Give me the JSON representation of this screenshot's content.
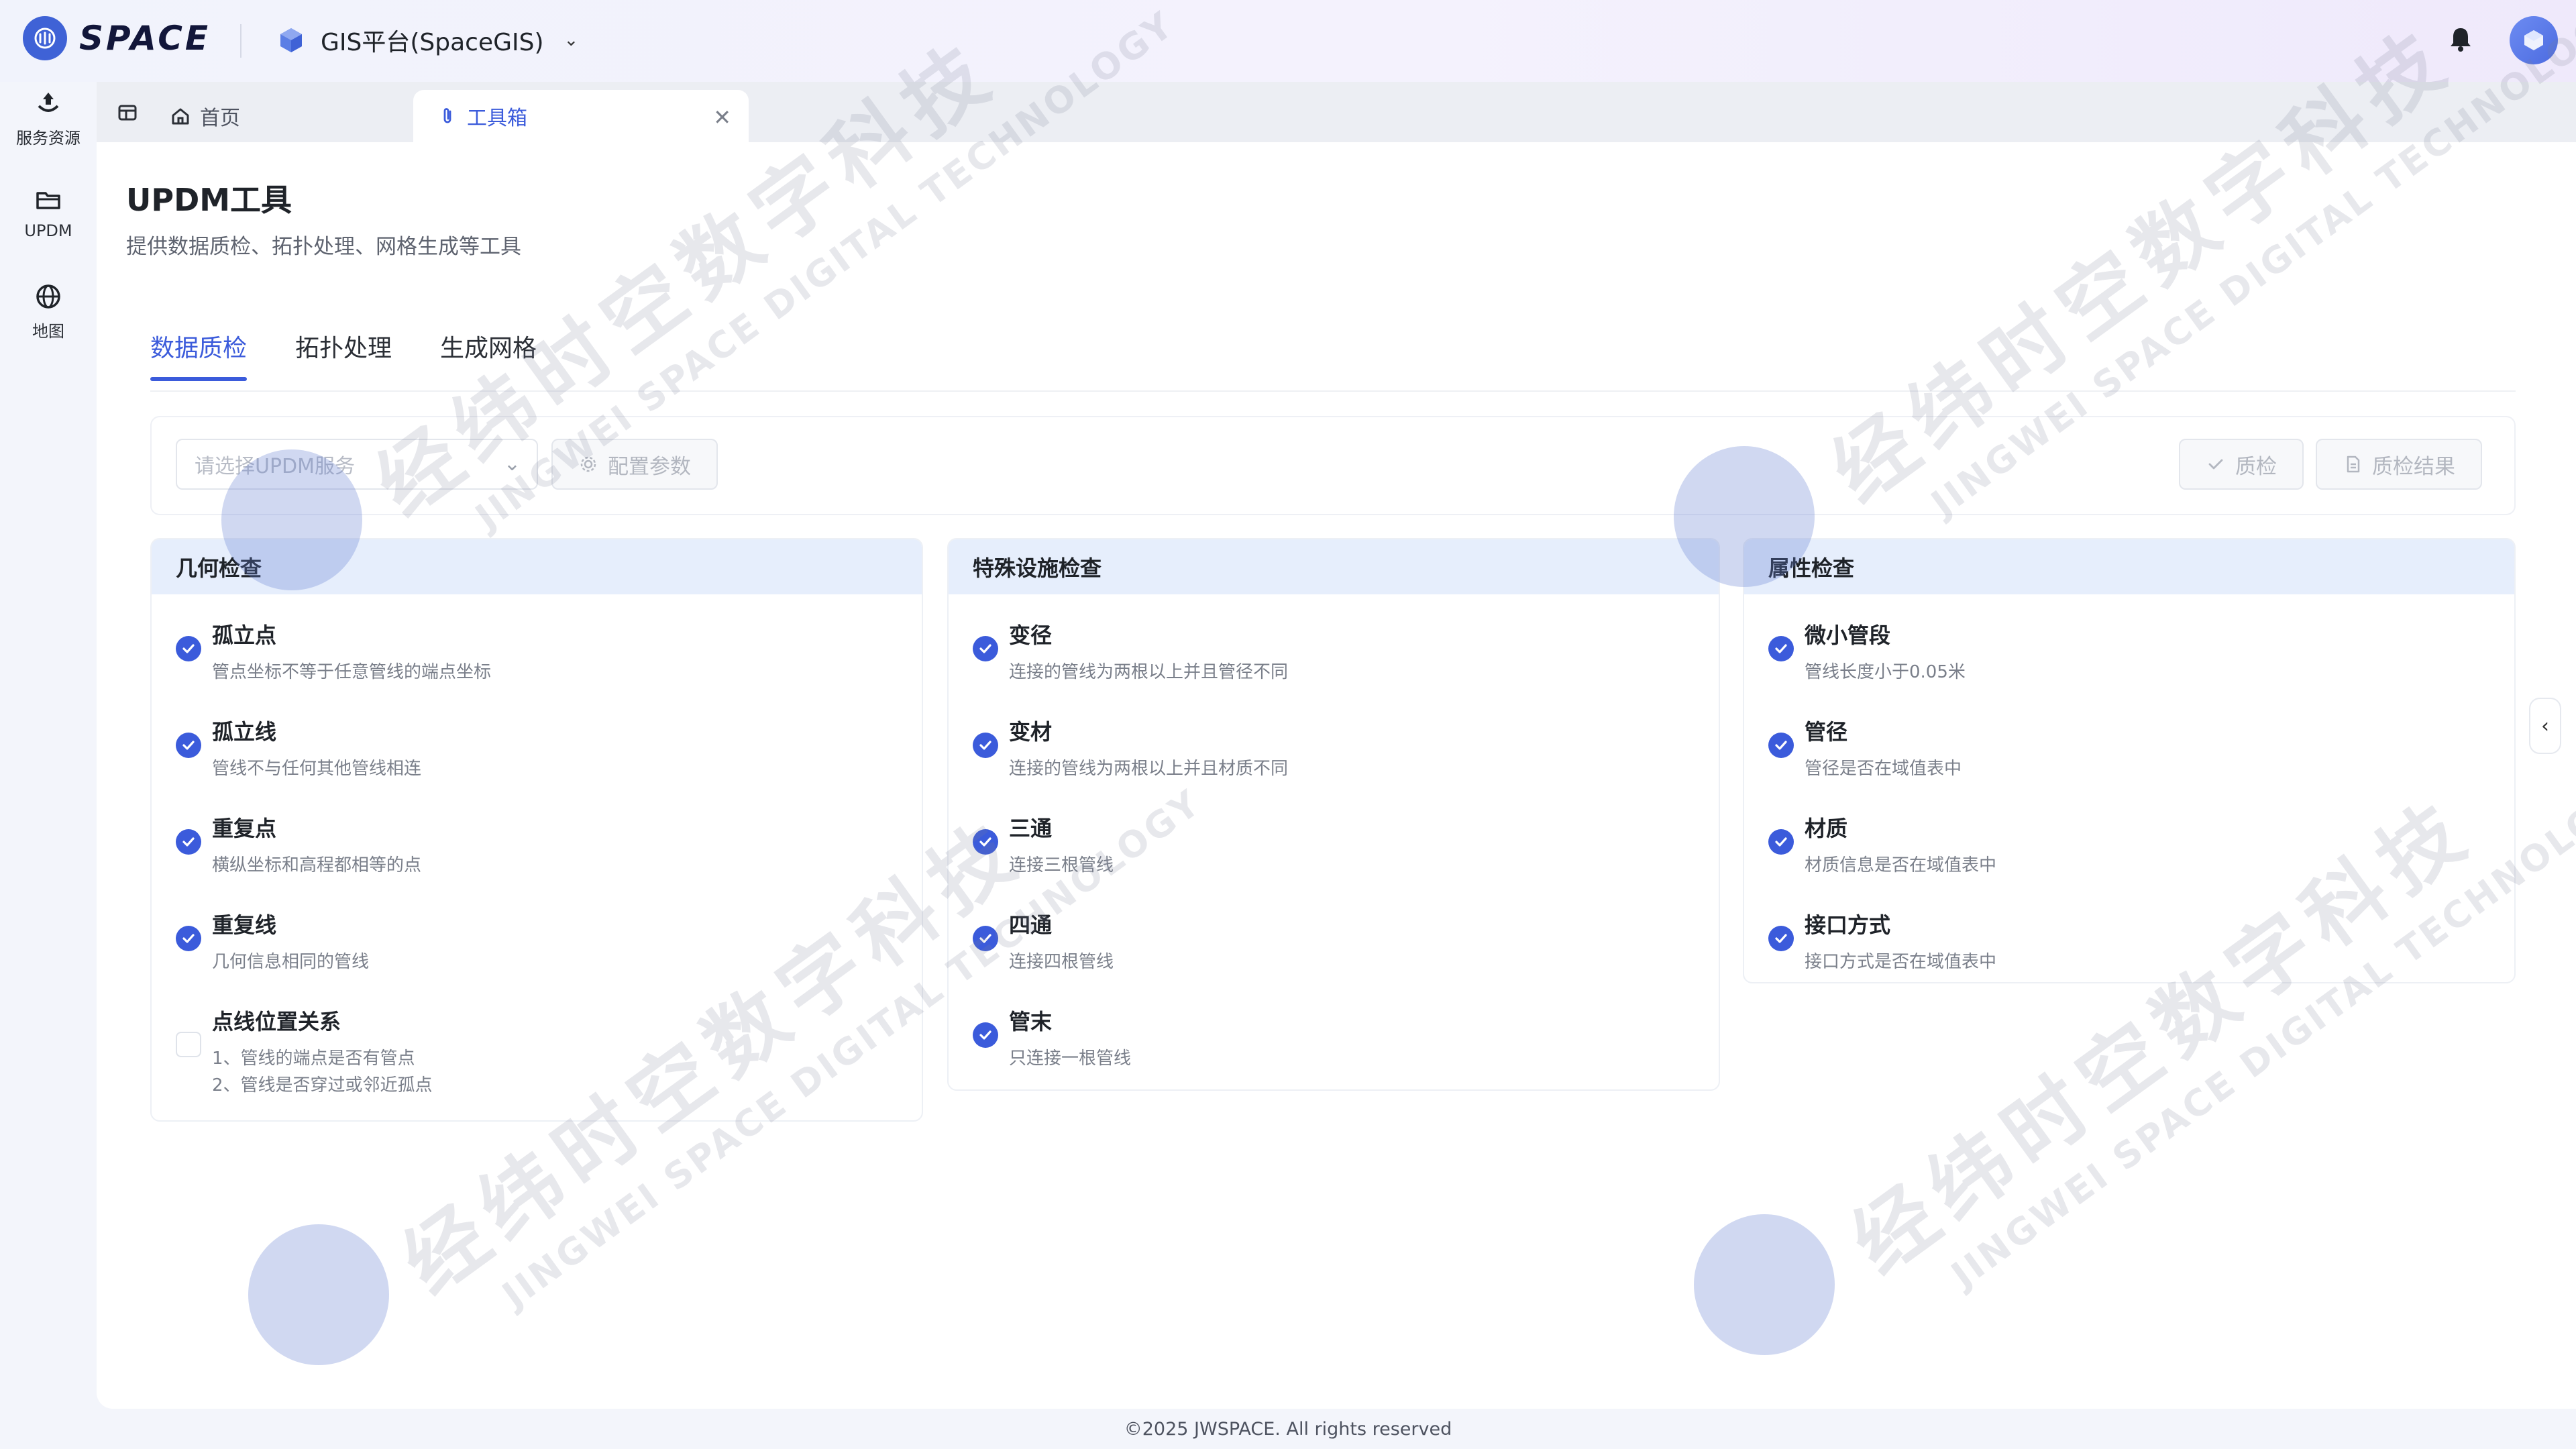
{
  "header": {
    "brand": "SPACE",
    "platform_name": "GIS平台(SpaceGIS)"
  },
  "sidebar": {
    "items": [
      {
        "label": "服务资源",
        "icon": "service-resource-icon"
      },
      {
        "label": "UPDM",
        "icon": "folder-icon"
      },
      {
        "label": "地图",
        "icon": "globe-icon"
      }
    ]
  },
  "tabs": {
    "home_label": "首页",
    "active_label": "工具箱"
  },
  "page": {
    "title": "UPDM工具",
    "subtitle": "提供数据质检、拓扑处理、网格生成等工具"
  },
  "subtabs": [
    "数据质检",
    "拓扑处理",
    "生成网格"
  ],
  "toolbar": {
    "select_placeholder": "请选择UPDM服务",
    "config_label": "配置参数",
    "qc_label": "质检",
    "result_label": "质检结果"
  },
  "cards": [
    {
      "title": "几何检查",
      "items": [
        {
          "title": "孤立点",
          "desc": "管点坐标不等于任意管线的端点坐标",
          "checked": true
        },
        {
          "title": "孤立线",
          "desc": "管线不与任何其他管线相连",
          "checked": true
        },
        {
          "title": "重复点",
          "desc": "横纵坐标和高程都相等的点",
          "checked": true
        },
        {
          "title": "重复线",
          "desc": "几何信息相同的管线",
          "checked": true
        },
        {
          "title": "点线位置关系",
          "desc": "1、管线的端点是否有管点\n2、管线是否穿过或邻近孤点",
          "checked": false
        }
      ]
    },
    {
      "title": "特殊设施检查",
      "items": [
        {
          "title": "变径",
          "desc": "连接的管线为两根以上并且管径不同",
          "checked": true
        },
        {
          "title": "变材",
          "desc": "连接的管线为两根以上并且材质不同",
          "checked": true
        },
        {
          "title": "三通",
          "desc": "连接三根管线",
          "checked": true
        },
        {
          "title": "四通",
          "desc": "连接四根管线",
          "checked": true
        },
        {
          "title": "管末",
          "desc": "只连接一根管线",
          "checked": true
        }
      ]
    },
    {
      "title": "属性检查",
      "items": [
        {
          "title": "微小管段",
          "desc": "管线长度小于0.05米",
          "checked": true
        },
        {
          "title": "管径",
          "desc": "管径是否在域值表中",
          "checked": true
        },
        {
          "title": "材质",
          "desc": "材质信息是否在域值表中",
          "checked": true
        },
        {
          "title": "接口方式",
          "desc": "接口方式是否在域值表中",
          "checked": true
        }
      ]
    }
  ],
  "watermark": {
    "cn": "经纬时空数字科技",
    "en": "JINGWEI SPACE DIGITAL TECHNOLOGY"
  },
  "footer": "©2025 JWSPACE. All rights reserved",
  "colors": {
    "accent": "#3b5bdb",
    "card_header": "#e6eefc",
    "page_bg": "#f3f5fb"
  }
}
